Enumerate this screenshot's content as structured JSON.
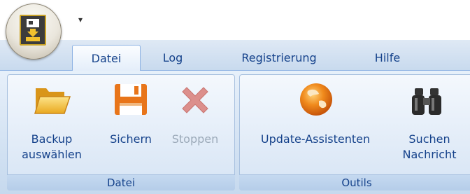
{
  "ribbon": {
    "tabs": [
      {
        "label": "Datei",
        "active": true
      },
      {
        "label": "Log",
        "active": false
      },
      {
        "label": "Registrierung",
        "active": false
      },
      {
        "label": "Hilfe",
        "active": false
      }
    ],
    "groups": [
      {
        "label": "Datei",
        "buttons": [
          {
            "label": "Backup\nauswählen",
            "icon": "folder-open-icon",
            "enabled": true
          },
          {
            "label": "Sichern",
            "icon": "floppy-disk-icon",
            "enabled": true
          },
          {
            "label": "Stoppen",
            "icon": "stop-x-icon",
            "enabled": false
          }
        ]
      },
      {
        "label": "Outils",
        "buttons": [
          {
            "label": "Update-Assistenten",
            "icon": "globe-icon",
            "enabled": true
          },
          {
            "label": "Suchen\nNachricht",
            "icon": "binoculars-icon",
            "enabled": true
          }
        ]
      }
    ]
  },
  "quick_access": {
    "glyph": "▾"
  },
  "colors": {
    "tab_text": "#15428b",
    "ribbon_border": "#8db2e3",
    "disabled_text": "#9ba9b8"
  }
}
